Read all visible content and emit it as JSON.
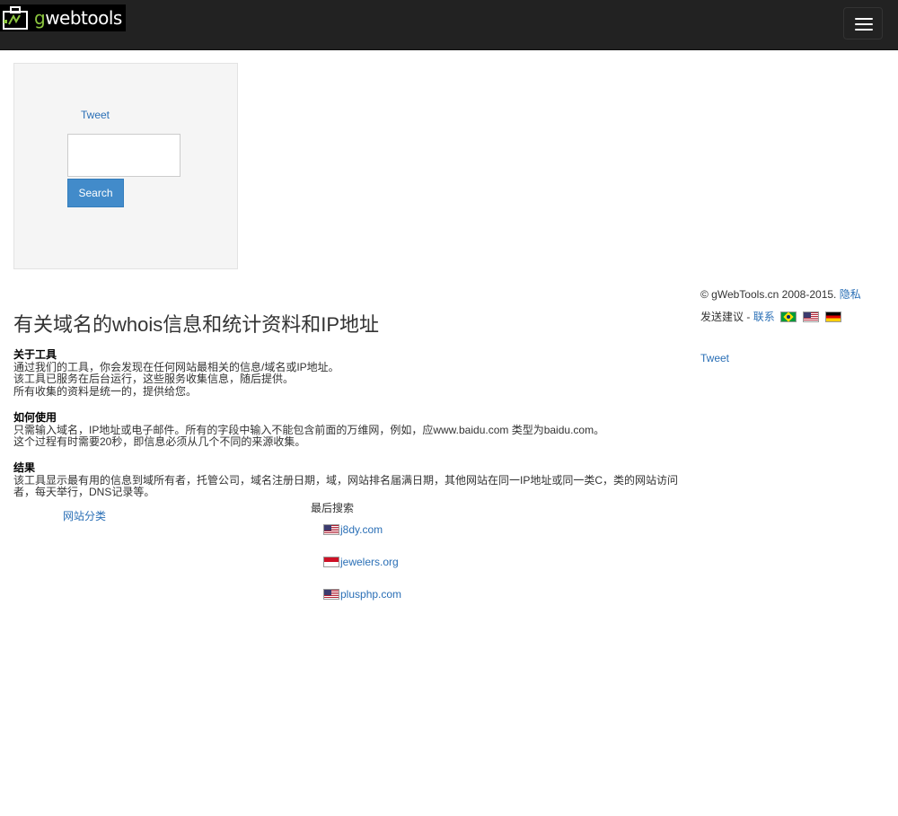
{
  "header": {
    "logo_text_a": "g",
    "logo_text_b": "webtools",
    "menu_icon": "hamburger-icon"
  },
  "search_box": {
    "tweet_label": "Tweet",
    "input_value": "",
    "button_label": "Search"
  },
  "main": {
    "title": "有关域名的whois信息和统计资料和IP地址",
    "about": {
      "heading": "关于工具",
      "lines": [
        "通过我们的工具，你会发现在任何网站最相关的信息/域名或IP地址。",
        "该工具已服务在后台运行，这些服务收集信息，随后提供。",
        "所有收集的资料是统一的，提供给您。"
      ]
    },
    "howto": {
      "heading": "如何使用",
      "lines": [
        "只需输入域名，IP地址或电子邮件。所有的字段中输入不能包含前面的万维网，例如，应www.baidu.com 类型为baidu.com。",
        "这个过程有时需要20秒，即信息必须从几个不同的来源收集。"
      ]
    },
    "results": {
      "heading": "结果",
      "text": "该工具显示最有用的信息到域所有者，托管公司，域名注册日期，域，网站排名届满日期，其他网站在同一IP地址或同一类C，类的网站访问者，每天举行，DNS记录等。"
    },
    "categories_link": "网站分类",
    "recent": {
      "title": "最后搜索",
      "items": [
        {
          "flag": "us-flag-icon",
          "domain": "j8dy.com"
        },
        {
          "flag": "indonesia-flag-icon",
          "domain": "jewelers.org"
        },
        {
          "flag": "us-flag-icon",
          "domain": "plusphp.com"
        }
      ]
    }
  },
  "sidebar": {
    "copyright": "© gWebTools.cn 2008-2015.",
    "privacy_link": "隐私",
    "feedback_label": "发送建议",
    "separator": " - ",
    "contact_link": "联系",
    "tweet_label": "Tweet"
  },
  "colors": {
    "navbar": "#222222",
    "link": "#2a6fb6",
    "button": "#428bca",
    "well": "#f5f5f5"
  }
}
